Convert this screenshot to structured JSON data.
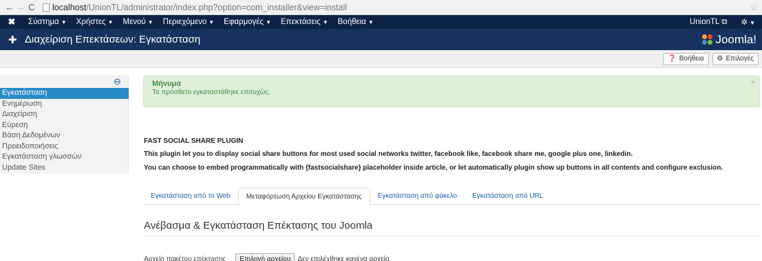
{
  "browser": {
    "url_host": "localhost",
    "url_path": "/UnionTL/administrator/index.php?option=com_installer&view=install"
  },
  "topmenu": {
    "items": [
      "Σύστημα",
      "Χρήστες",
      "Μενού",
      "Περιεχόμενο",
      "Εφαρμογές",
      "Επεκτάσεις",
      "Βοήθεια"
    ],
    "site_name": "UnionTL"
  },
  "header": {
    "title": "Διαχείριση Επεκτάσεων: Εγκατάσταση",
    "brand": "Joomla!"
  },
  "toolbar": {
    "help_label": "Βοήθεια",
    "options_label": "Επιλογές"
  },
  "sidebar": {
    "items": [
      {
        "label": "Εγκατάσταση"
      },
      {
        "label": "Ενημέρωση"
      },
      {
        "label": "Διαχείριση"
      },
      {
        "label": "Εύρεση"
      },
      {
        "label": "Βάση Δεδομένων"
      },
      {
        "label": "Προειδοποιήσεις"
      },
      {
        "label": "Εγκατάσταση γλωσσών"
      },
      {
        "label": "Update Sites"
      }
    ]
  },
  "message": {
    "heading": "Μήνυμα",
    "text": "Το πρόσθετο εγκαταστάθηκε επιτυχώς.",
    "close": "×"
  },
  "plugin": {
    "title": "FAST SOCIAL SHARE PLUGIN",
    "desc1": "This plugin let you to display social share buttons for most used social networks twitter, facebook like, facebook share me, google plus one, linkedin.",
    "desc2": "You can choose to embed programmatically with {fastsocialshare} placeholder inside article, or let automatically plugin show up buttons in all contents and configure exclusion."
  },
  "tabs": [
    "Εγκατάσταση από το Web",
    "Μεταφόρτωση Αρχείου Εγκατάστασης",
    "Εγκατάσταση από φάκελο",
    "Εγκατάσταση από URL"
  ],
  "upload": {
    "section_title": "Ανέβασμα & Εγκατάσταση Επέκτασης του Joomla",
    "file_label": "Αρχείο πακέτου επέκτασης",
    "choose_button": "Επιλογή αρχείου",
    "no_file_text": "Δεν επιλέχθηκε κανένα αρχείο."
  },
  "colors": {
    "menu_bg": "#0c2347",
    "header_bg": "#17325c",
    "active_sidebar": "#2a8bc9",
    "alert_bg": "#dff0d8",
    "link": "#1a5fa8"
  }
}
